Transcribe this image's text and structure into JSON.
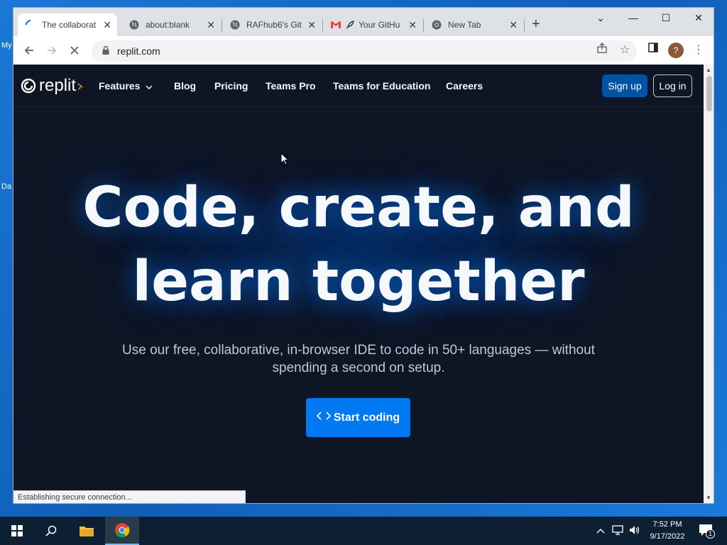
{
  "desktop": {
    "labels": [
      "My",
      "Da"
    ]
  },
  "browser": {
    "tabs": [
      {
        "title": "The collaborat",
        "active": true
      },
      {
        "title": "about:blank",
        "active": false
      },
      {
        "title": "RAFhub6's Git",
        "active": false
      },
      {
        "title": "Your GitHu",
        "active": false
      },
      {
        "title": "New Tab",
        "active": false
      }
    ],
    "address": "replit.com",
    "status": "Establishing secure connection...",
    "avatar_letter": "?"
  },
  "site": {
    "logo_text": "replit",
    "nav": [
      "Features",
      "Blog",
      "Pricing",
      "Teams Pro",
      "Teams for Education",
      "Careers"
    ],
    "signup": "Sign up",
    "login": "Log in",
    "hero_line1": "Code, create, and",
    "hero_line2": "learn together",
    "subtitle_line1": "Use our free, collaborative, in-browser IDE to code in 50+ languages — without",
    "subtitle_line2": "spending a second on setup.",
    "cta": "Start coding",
    "cta_icon": "<>"
  },
  "taskbar": {
    "time": "7:52 PM",
    "date": "9/17/2022",
    "notification_count": "1"
  },
  "colors": {
    "site_bg": "#0e1525",
    "cta": "#0079f2",
    "signup_bg": "#0053a6"
  }
}
